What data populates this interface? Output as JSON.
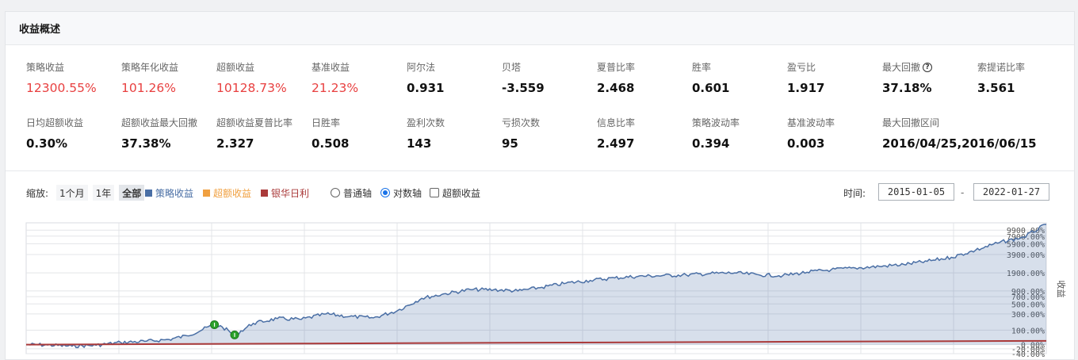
{
  "panel": {
    "title": "收益概述"
  },
  "metrics_row1": [
    {
      "label": "策略收益",
      "value": "12300.55%",
      "red": true
    },
    {
      "label": "策略年化收益",
      "value": "101.26%",
      "red": true
    },
    {
      "label": "超额收益",
      "value": "10128.73%",
      "red": true
    },
    {
      "label": "基准收益",
      "value": "21.23%",
      "red": true
    },
    {
      "label": "阿尔法",
      "value": "0.931"
    },
    {
      "label": "贝塔",
      "value": "-3.559"
    },
    {
      "label": "夏普比率",
      "value": "2.468"
    },
    {
      "label": "胜率",
      "value": "0.601"
    },
    {
      "label": "盈亏比",
      "value": "1.917"
    },
    {
      "label": "最大回撤",
      "value": "37.18%"
    },
    {
      "label": "索提诺比率",
      "value": "3.561"
    }
  ],
  "metrics_row2": [
    {
      "label": "日均超额收益",
      "value": "0.30%"
    },
    {
      "label": "超额收益最大回撤",
      "value": "37.38%"
    },
    {
      "label": "超额收益夏普比率",
      "value": "2.327"
    },
    {
      "label": "日胜率",
      "value": "0.508"
    },
    {
      "label": "盈利次数",
      "value": "143"
    },
    {
      "label": "亏损次数",
      "value": "95"
    },
    {
      "label": "信息比率",
      "value": "2.497"
    },
    {
      "label": "策略波动率",
      "value": "0.394"
    },
    {
      "label": "基准波动率",
      "value": "0.003"
    },
    {
      "label": "最大回撤区间",
      "value": "2016/04/25,2016/06/15"
    }
  ],
  "help_icon": "question-circle-icon",
  "toolbar": {
    "zoom_label": "缩放:",
    "zoom_options": [
      "1个月",
      "1年",
      "全部"
    ],
    "zoom_active": "全部",
    "legend": [
      {
        "name": "策略收益",
        "color": "#4a6fa5"
      },
      {
        "name": "超额收益",
        "color": "#f0a040"
      },
      {
        "name": "银华日利",
        "color": "#aa3a3a"
      }
    ],
    "axis_options": [
      "普通轴",
      "对数轴"
    ],
    "axis_selected": "对数轴",
    "excess_checkbox": "超额收益",
    "time_label": "时间:",
    "date_from": "2015-01-05",
    "date_to": "2022-01-27",
    "date_sep": "-"
  },
  "chart_data": {
    "type": "area",
    "y_scale": "log",
    "ylabel": "收益",
    "x_range": [
      "2015-01-05",
      "2022-01-27"
    ],
    "y_ticks": [
      "9900.00%",
      "7900.00%",
      "5900.00%",
      "3900.00%",
      "1900.00%",
      "900.00%",
      "700.00%",
      "500.00%",
      "300.00%",
      "100.00%",
      "0.00%",
      "-20.00%",
      "-40.00%"
    ],
    "y_tick_values": [
      9900,
      7900,
      5900,
      3900,
      1900,
      900,
      700,
      500,
      300,
      100,
      0,
      -20,
      -40
    ],
    "series": [
      {
        "name": "策略收益",
        "color": "#4a6fa5",
        "points": [
          [
            "2015-01-05",
            0
          ],
          [
            "2015-03-01",
            -2
          ],
          [
            "2015-05-01",
            -8
          ],
          [
            "2015-07-01",
            -3
          ],
          [
            "2015-09-01",
            12
          ],
          [
            "2015-11-01",
            18
          ],
          [
            "2016-01-01",
            30
          ],
          [
            "2016-02-15",
            55
          ],
          [
            "2016-04-25",
            155
          ],
          [
            "2016-05-15",
            130
          ],
          [
            "2016-06-15",
            61
          ],
          [
            "2016-08-01",
            170
          ],
          [
            "2016-10-01",
            230
          ],
          [
            "2016-12-01",
            220
          ],
          [
            "2017-02-01",
            300
          ],
          [
            "2017-04-01",
            260
          ],
          [
            "2017-06-01",
            240
          ],
          [
            "2017-08-01",
            360
          ],
          [
            "2017-10-01",
            650
          ],
          [
            "2017-12-01",
            800
          ],
          [
            "2018-02-01",
            950
          ],
          [
            "2018-04-01",
            950
          ],
          [
            "2018-06-01",
            900
          ],
          [
            "2018-08-01",
            1050
          ],
          [
            "2018-10-01",
            1250
          ],
          [
            "2018-12-01",
            1400
          ],
          [
            "2019-02-01",
            1550
          ],
          [
            "2019-04-01",
            1650
          ],
          [
            "2019-06-01",
            1700
          ],
          [
            "2019-08-01",
            1750
          ],
          [
            "2019-10-01",
            1850
          ],
          [
            "2019-12-01",
            1900
          ],
          [
            "2020-02-01",
            1750
          ],
          [
            "2020-04-01",
            1700
          ],
          [
            "2020-06-01",
            1950
          ],
          [
            "2020-08-01",
            2150
          ],
          [
            "2020-10-01",
            2300
          ],
          [
            "2020-12-01",
            2450
          ],
          [
            "2021-02-01",
            2650
          ],
          [
            "2021-04-01",
            3000
          ],
          [
            "2021-06-01",
            3500
          ],
          [
            "2021-08-01",
            4600
          ],
          [
            "2021-10-01",
            6200
          ],
          [
            "2021-12-01",
            7600
          ],
          [
            "2022-01-27",
            12300
          ]
        ]
      },
      {
        "name": "银华日利",
        "color": "#aa3a3a",
        "points": [
          [
            "2015-01-05",
            0
          ],
          [
            "2016-01-01",
            3
          ],
          [
            "2017-01-01",
            6
          ],
          [
            "2018-01-01",
            9
          ],
          [
            "2019-01-01",
            12
          ],
          [
            "2020-01-01",
            15
          ],
          [
            "2021-01-01",
            18
          ],
          [
            "2022-01-27",
            21
          ]
        ]
      }
    ],
    "markers": [
      {
        "date": "2016-04-25",
        "value": 155,
        "color": "#2aa12a"
      },
      {
        "date": "2016-06-15",
        "value": 61,
        "color": "#2aa12a"
      }
    ],
    "grid": true,
    "legend_position": "top-left"
  }
}
